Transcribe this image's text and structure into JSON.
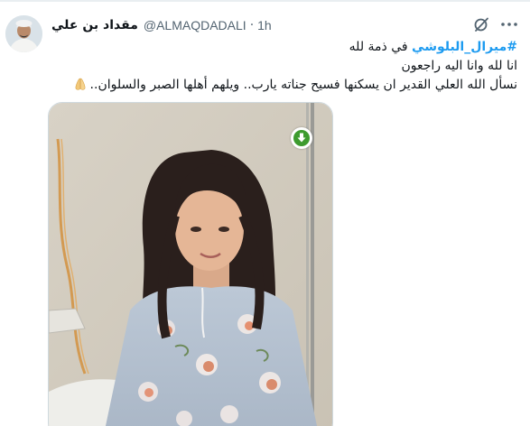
{
  "tweet": {
    "author_name": "مقداد بن علي",
    "handle": "@ALMAQDADALI",
    "separator": "·",
    "time": "1h",
    "line1_hashtag": "#ميرال_البلوشي",
    "line1_rest": " في ذمة لله",
    "line2": "انا لله وانا اليه راجعون",
    "line3": "نسأل الله العلي القدير ان يسكنها فسيح جناته يارب.. ويلهم أهلها الصبر والسلوان..",
    "emoji": "folded-hands-emoji"
  },
  "icons": {
    "grok": "grok-icon",
    "more": "more-options-icon",
    "download": "download-icon"
  },
  "colors": {
    "link": "#1d9bf0",
    "secondary_text": "#536471",
    "text": "#0f1419",
    "download_badge": "#3d9b2e"
  }
}
